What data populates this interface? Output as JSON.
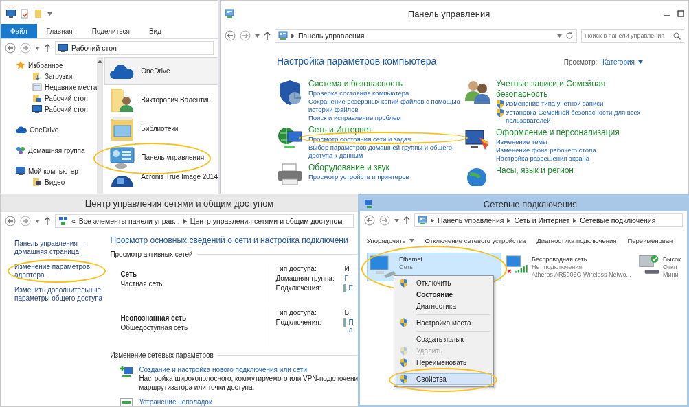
{
  "explorer": {
    "tabs": [
      {
        "label": "Файл",
        "selected": true
      },
      {
        "label": "Главная",
        "selected": false
      },
      {
        "label": "Поделиться",
        "selected": false
      },
      {
        "label": "Вид",
        "selected": false
      }
    ],
    "address": [
      "Рабочий стол"
    ],
    "nav": [
      {
        "label": "Избранное",
        "kind": "favorites",
        "children": [
          {
            "label": "Загрузки",
            "kind": "downloads"
          },
          {
            "label": "Недавние места",
            "kind": "recent"
          },
          {
            "label": "Рабочий стол",
            "kind": "folder"
          },
          {
            "label": "Рабочий стол",
            "kind": "desktop"
          }
        ]
      },
      {
        "label": "OneDrive",
        "kind": "cloud"
      },
      {
        "label": "Домашняя группа",
        "kind": "homegroup"
      },
      {
        "label": "Мой компьютер",
        "kind": "computer",
        "children": [
          {
            "label": "Видео",
            "kind": "video"
          }
        ]
      }
    ],
    "items": [
      {
        "label": "OneDrive",
        "kind": "cloud",
        "selected": true,
        "highlighted": false
      },
      {
        "label": "Викторович Валентин",
        "kind": "user-folder",
        "selected": false,
        "highlighted": false
      },
      {
        "label": "Библиотеки",
        "kind": "library",
        "selected": false,
        "highlighted": false
      },
      {
        "label": "Панель управления",
        "kind": "control-panel",
        "selected": false,
        "highlighted": true
      },
      {
        "label": "Acronis True Image 2014",
        "kind": "app",
        "selected": false,
        "highlighted": false
      }
    ]
  },
  "control_panel": {
    "title": "Панель управления",
    "address": [
      "Панель управления"
    ],
    "search": {
      "placeholder": "Поиск в панели управления"
    },
    "heading": "Настройка параметров компьютера",
    "view_label": "Просмотр:",
    "view_value": "Категория",
    "columns": [
      [
        {
          "title": "Система и безопасность",
          "kind": "security",
          "links": [
            {
              "label": "Проверка состояния компьютера",
              "shield": false,
              "highlighted": false
            },
            {
              "label": "Сохранение резервных копий файлов с помощью истории файлов",
              "shield": false,
              "highlighted": false
            },
            {
              "label": "Поиск и исправление проблем",
              "shield": false,
              "highlighted": false
            }
          ]
        },
        {
          "title": "Сеть и Интернет",
          "kind": "network",
          "links": [
            {
              "label": "Просмотр состояния сети и задач",
              "shield": false,
              "highlighted": true
            },
            {
              "label": "Выбор параметров домашней группы и общего доступа к данным",
              "shield": false,
              "highlighted": false
            }
          ]
        },
        {
          "title": "Оборудование и звук",
          "kind": "hardware",
          "links": [
            {
              "label": "Просмотр устройств и принтеров",
              "shield": false,
              "highlighted": false
            }
          ]
        }
      ],
      [
        {
          "title": "Учетные записи и Семейная безопасность",
          "kind": "accounts",
          "links": [
            {
              "label": "Изменение типа учетной записи",
              "shield": true,
              "highlighted": false
            },
            {
              "label": "Установка Семейной безопасности для всех пользователей",
              "shield": true,
              "highlighted": false
            }
          ]
        },
        {
          "title": "Оформление и персонализация",
          "kind": "appearance",
          "links": [
            {
              "label": "Изменение темы",
              "shield": false,
              "highlighted": false
            },
            {
              "label": "Изменение фона рабочего стола",
              "shield": false,
              "highlighted": false
            },
            {
              "label": "Настройка разрешения экрана",
              "shield": false,
              "highlighted": false
            }
          ]
        },
        {
          "title": "Часы, язык и регион",
          "kind": "clock"
        }
      ]
    ]
  },
  "network_center": {
    "title": "Центр управления сетями и общим доступом",
    "address_prefix": "«",
    "address": [
      "Все элементы панели управ...",
      "Центр управления сетями и общим доступом"
    ],
    "sidebar": [
      {
        "label": "Панель управления — домашняя страница",
        "highlighted": false
      },
      {
        "label": "Изменение параметров адаптера",
        "highlighted": true
      },
      {
        "label": "Изменить дополнительные параметры общего доступа",
        "highlighted": false
      }
    ],
    "heading": "Просмотр основных сведений о сети и настройка подключени",
    "active_label": "Просмотр активных сетей",
    "networks": [
      {
        "name": "Сеть",
        "type": "Частная сеть",
        "props": [
          {
            "label": "Тип доступа:",
            "value": "И",
            "link": false
          },
          {
            "label": "Домашняя группа:",
            "value": "Г",
            "link": true
          },
          {
            "label": "Подключения:",
            "value": "E",
            "link": true,
            "icon": true
          }
        ]
      },
      {
        "name": "Неопознанная сеть",
        "type": "Общедоступная сеть",
        "props": [
          {
            "label": "Тип доступа:",
            "value": "Б",
            "link": false
          },
          {
            "label": "Подключения:",
            "value": "П\nл",
            "link": true,
            "icon": true
          }
        ]
      }
    ],
    "change_label": "Изменение сетевых параметров",
    "tasks": [
      {
        "title": "Создание и настройка нового подключения или сети",
        "kind": "new-connection",
        "desc": [
          "Настройка широкополосного, коммутируемого или VPN-подключени",
          "маршрутизатора или точки доступа."
        ]
      },
      {
        "title": "Устранение неполадок",
        "kind": "troubleshoot"
      }
    ]
  },
  "connections": {
    "title": "Сетевые подключения",
    "address": [
      "Панель управления",
      "Сеть и Интернет",
      "Сетевые подключения"
    ],
    "toolbar": [
      {
        "label": "Упорядочить",
        "dropdown": true
      },
      {
        "label": "Отключение сетевого устройства",
        "dropdown": false
      },
      {
        "label": "Диагностика подключения",
        "dropdown": false
      },
      {
        "label": "Переименован",
        "dropdown": false
      }
    ],
    "adapters": [
      {
        "name": "Ethernet",
        "status": "Сеть",
        "kind": "wired",
        "selected": true,
        "highlighted": true
      },
      {
        "name": "Беспроводная сеть",
        "status": "Нет подключения",
        "device": "Atheros AR5005G Wireless Netwo...",
        "kind": "wireless",
        "selected": false,
        "highlighted": false
      },
      {
        "name": "Высок",
        "status": "Откл",
        "device": "Мини",
        "kind": "modem",
        "selected": false,
        "highlighted": false
      }
    ],
    "menu": [
      {
        "kind": "item",
        "label": "Отключить",
        "shield": true,
        "disabled": false,
        "selected": false
      },
      {
        "kind": "item",
        "label": "Состояние",
        "shield": false,
        "bold": true,
        "disabled": false,
        "selected": false
      },
      {
        "kind": "item",
        "label": "Диагностика",
        "shield": false,
        "disabled": false,
        "selected": false
      },
      {
        "kind": "separator"
      },
      {
        "kind": "item",
        "label": "Настройка моста",
        "shield": true,
        "disabled": false,
        "selected": false
      },
      {
        "kind": "separator"
      },
      {
        "kind": "item",
        "label": "Создать ярлык",
        "shield": false,
        "disabled": false,
        "selected": false
      },
      {
        "kind": "item",
        "label": "Удалить",
        "shield": true,
        "disabled": true,
        "selected": false
      },
      {
        "kind": "item",
        "label": "Переименовать",
        "shield": true,
        "disabled": false,
        "selected": false
      },
      {
        "kind": "separator"
      },
      {
        "kind": "item",
        "label": "Свойства",
        "shield": true,
        "disabled": false,
        "selected": true,
        "highlighted": true
      }
    ]
  }
}
